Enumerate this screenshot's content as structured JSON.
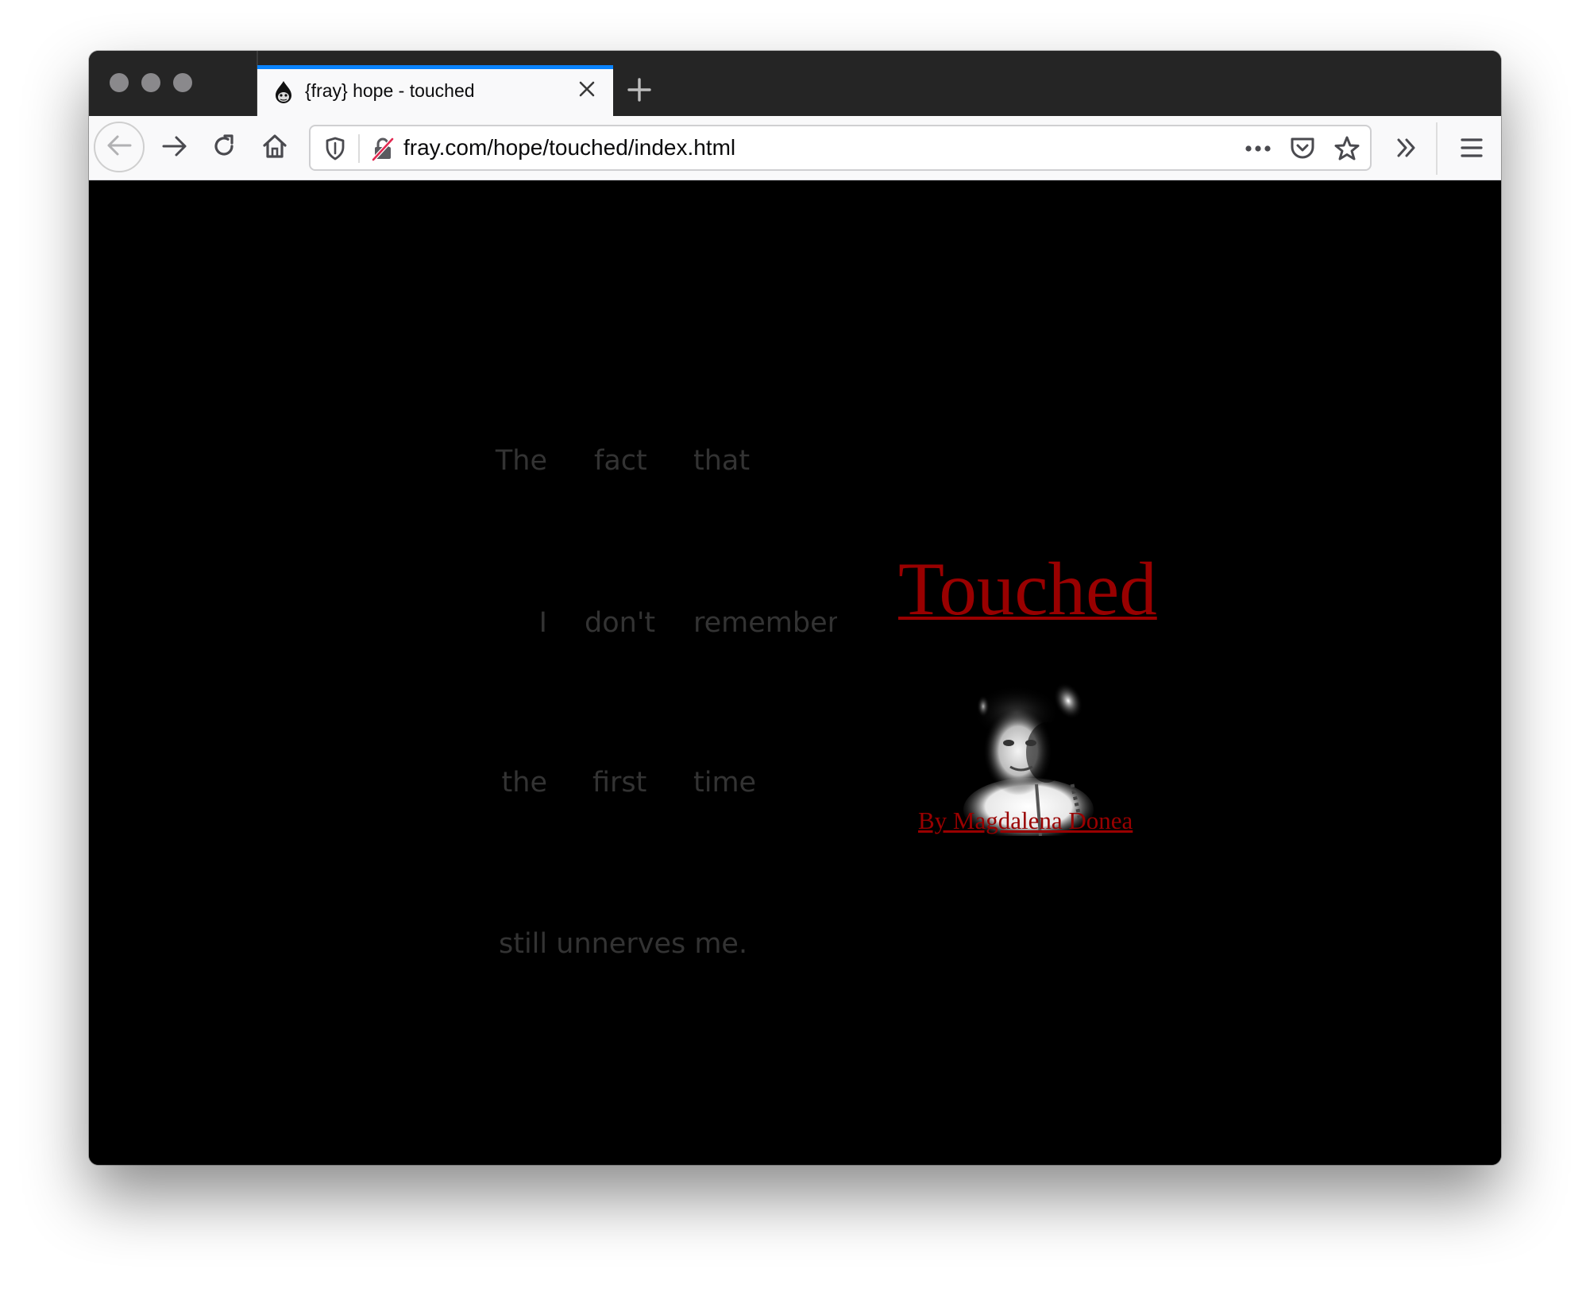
{
  "browser": {
    "tab": {
      "title": "{fray} hope - touched",
      "favicon": "fray-flame-face-icon",
      "accent_color": "#0a84ff"
    },
    "toolbar": {
      "back": "back-arrow-icon",
      "forward": "forward-arrow-icon",
      "reload": "reload-icon",
      "home": "home-icon",
      "url": "fray.com/hope/touched/index.html",
      "tracking_protection": "shield-icon",
      "connection": "insecure-lock-icon",
      "page_actions": "ellipsis-icon",
      "pocket": "pocket-icon",
      "bookmark": "star-icon",
      "overflow": "double-chevron-icon",
      "menu": "hamburger-menu-icon"
    }
  },
  "page": {
    "background": "#000000",
    "poem": {
      "color": "#333333",
      "rows": [
        [
          "The",
          "fact",
          "that"
        ],
        [
          "I",
          "don't",
          "remember"
        ],
        [
          "the",
          "first",
          "time"
        ]
      ],
      "last_line": "still unnerves me."
    },
    "title": "Touched",
    "title_color": "#990000",
    "portrait_alt": "black and white photo of a young girl",
    "byline": "By Magdalena Donea"
  }
}
